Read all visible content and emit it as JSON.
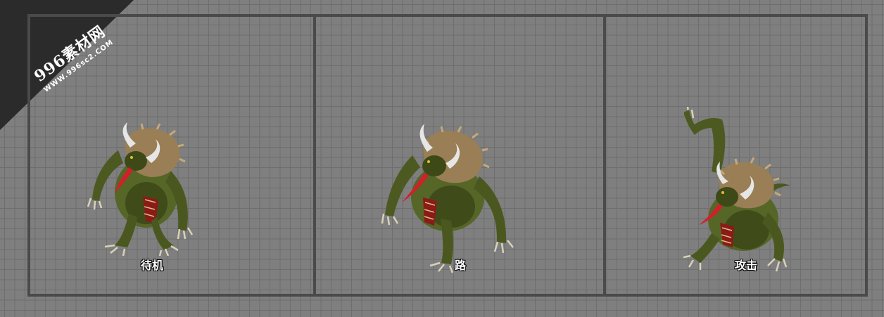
{
  "watermark": {
    "site_name": "996素材网",
    "site_url": "WWW.996sc2.COM"
  },
  "panels": [
    {
      "label": "待机",
      "sprite_icon": "ox-demon-idle-sprite"
    },
    {
      "label": "路",
      "sprite_icon": "ox-demon-walk-sprite"
    },
    {
      "label": "攻击",
      "sprite_icon": "ox-demon-attack-sprite"
    }
  ],
  "colors": {
    "background": "#7f7f7f",
    "grid_line": "#6e6e6e",
    "frame": "#4a4a4a",
    "label_text": "#ffffff",
    "watermark_band": "#2b2b2b"
  }
}
